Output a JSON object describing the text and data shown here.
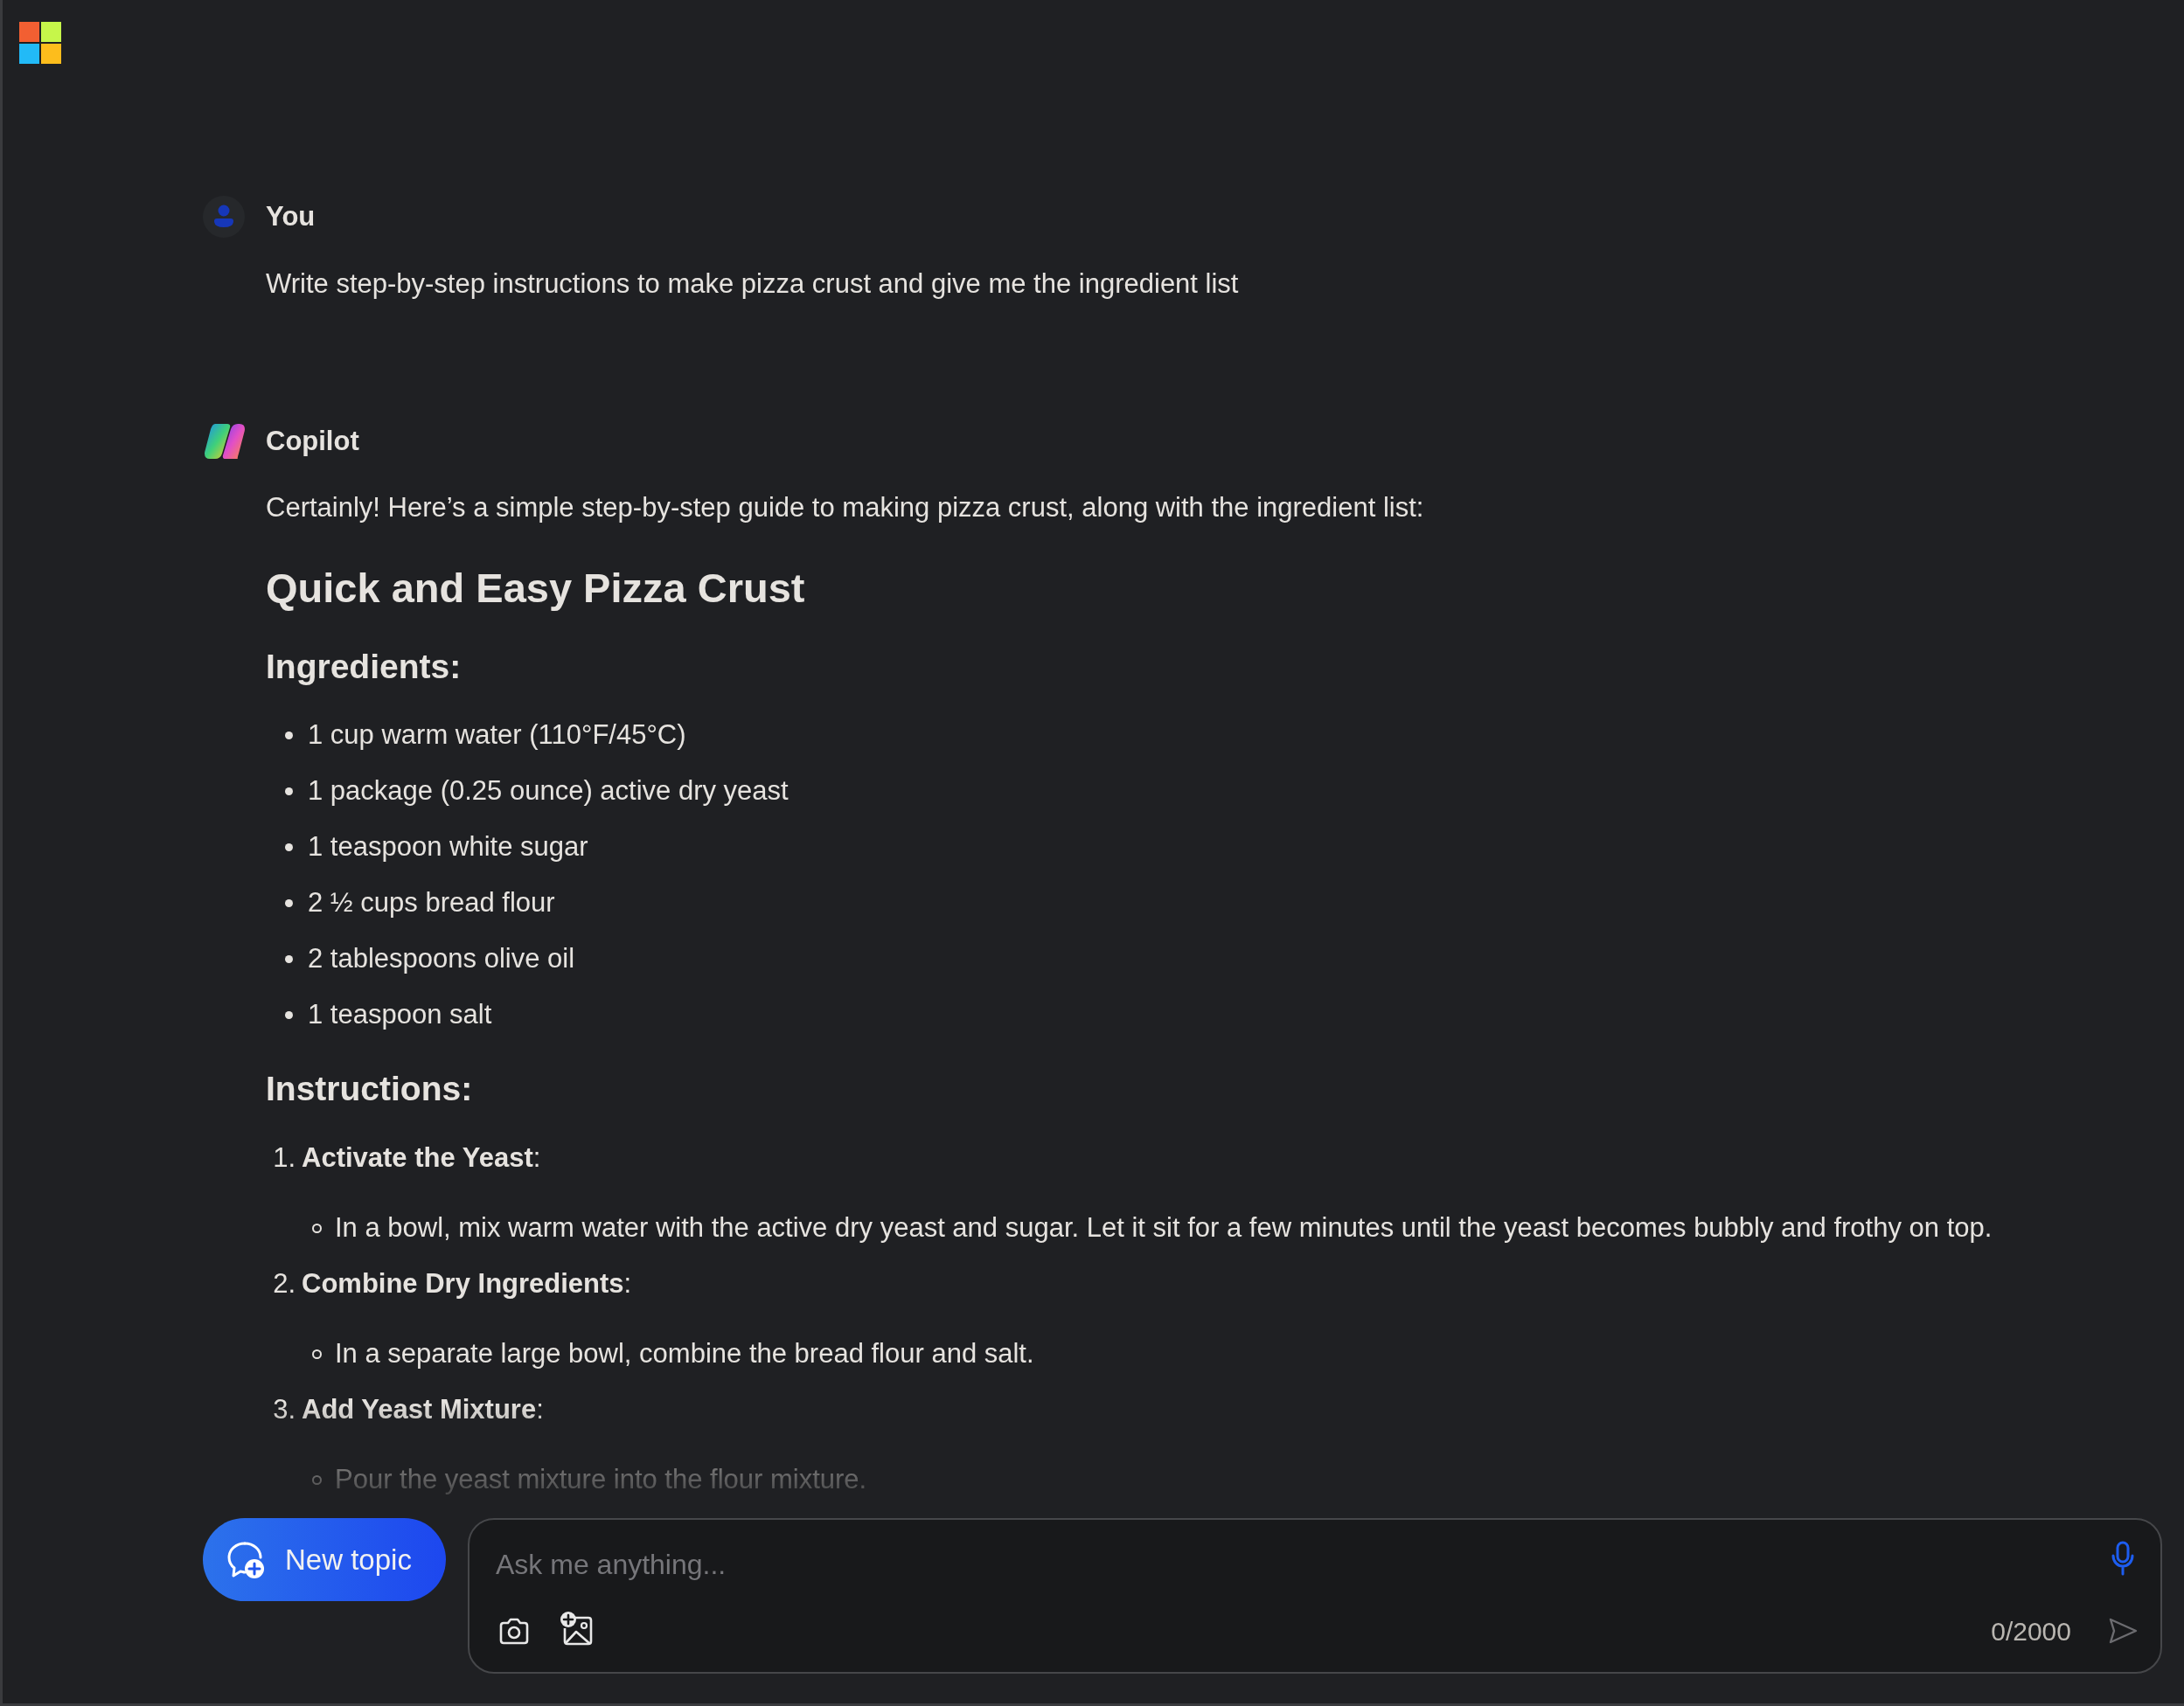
{
  "messages": [
    {
      "kind": "user",
      "author": "You",
      "text": "Write step-by-step instructions to make pizza crust and give me the ingredient list"
    },
    {
      "kind": "assistant",
      "author": "Copilot",
      "intro": "Certainly! Here’s a simple step-by-step guide to making pizza crust, along with the ingredient list:",
      "title": "Quick and Easy Pizza Crust",
      "sections": [
        {
          "kind": "bullets",
          "heading": "Ingredients:",
          "items": [
            "1 cup warm water (110°F/45°C)",
            "1 package (0.25 ounce) active dry yeast",
            "1 teaspoon white sugar",
            "2 ½ cups bread flour",
            "2 tablespoons olive oil",
            "1 teaspoon salt"
          ]
        },
        {
          "kind": "steps",
          "heading": "Instructions:",
          "items": [
            {
              "number": "1.",
              "text": "**Activate the Yeast**:",
              "details": [
                "In a bowl, mix warm water with the active dry yeast and sugar. Let it sit for a few minutes until the yeast becomes bubbly and frothy on top."
              ]
            },
            {
              "number": "2.",
              "text": "**Combine Dry Ingredients**:",
              "details": [
                "In a separate large bowl, combine the bread flour and salt."
              ]
            },
            {
              "number": "3.",
              "text": "**Add Yeast Mixture**:",
              "details": [
                "Pour the yeast mixture into the flour mixture."
              ]
            }
          ]
        }
      ]
    }
  ],
  "composer": {
    "new_topic": "New topic",
    "placeholder": "Ask me anything...",
    "counter": "0/2000"
  }
}
